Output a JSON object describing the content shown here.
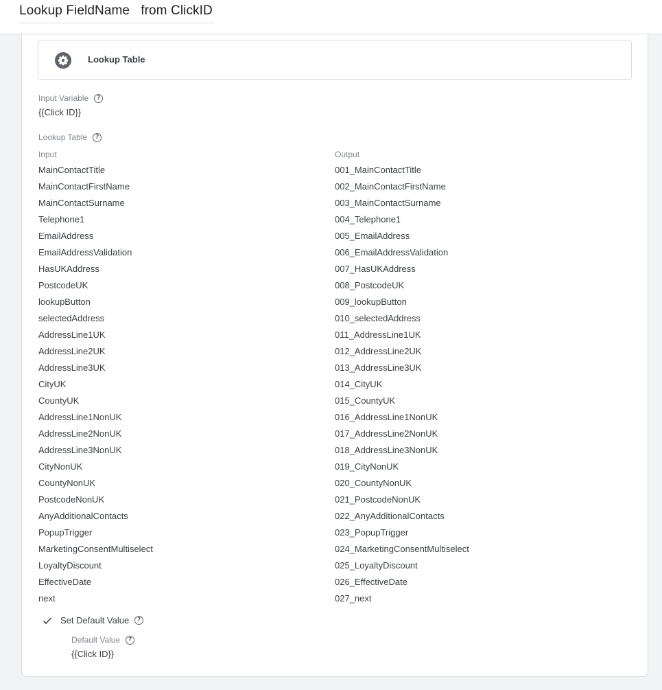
{
  "header": {
    "title": "Lookup FieldName   from ClickID"
  },
  "variable_type": {
    "label": "Lookup Table",
    "icon": "gear-icon"
  },
  "input_variable": {
    "label": "Input Variable",
    "value": "{{Click ID}}"
  },
  "lookup_table": {
    "label": "Lookup Table",
    "input_header": "Input",
    "output_header": "Output",
    "rows": [
      {
        "input": "MainContactTitle",
        "output": "001_MainContactTitle"
      },
      {
        "input": "MainContactFirstName",
        "output": "002_MainContactFirstName"
      },
      {
        "input": "MainContactSurname",
        "output": "003_MainContactSurname"
      },
      {
        "input": "Telephone1",
        "output": "004_Telephone1"
      },
      {
        "input": "EmailAddress",
        "output": "005_EmailAddress"
      },
      {
        "input": "EmailAddressValidation",
        "output": "006_EmailAddressValidation"
      },
      {
        "input": "HasUKAddress",
        "output": "007_HasUKAddress"
      },
      {
        "input": "PostcodeUK",
        "output": "008_PostcodeUK"
      },
      {
        "input": "lookupButton",
        "output": "009_lookupButton"
      },
      {
        "input": "selectedAddress",
        "output": "010_selectedAddress"
      },
      {
        "input": "AddressLine1UK",
        "output": "011_AddressLine1UK"
      },
      {
        "input": "AddressLine2UK",
        "output": "012_AddressLine2UK"
      },
      {
        "input": "AddressLine3UK",
        "output": "013_AddressLine3UK"
      },
      {
        "input": "CityUK",
        "output": "014_CityUK"
      },
      {
        "input": "CountyUK",
        "output": "015_CountyUK"
      },
      {
        "input": "AddressLine1NonUK",
        "output": "016_AddressLine1NonUK"
      },
      {
        "input": "AddressLine2NonUK",
        "output": "017_AddressLine2NonUK"
      },
      {
        "input": "AddressLine3NonUK",
        "output": "018_AddressLine3NonUK"
      },
      {
        "input": "CityNonUK",
        "output": "019_CityNonUK"
      },
      {
        "input": "CountyNonUK",
        "output": "020_CountyNonUK"
      },
      {
        "input": "PostcodeNonUK",
        "output": "021_PostcodeNonUK"
      },
      {
        "input": "AnyAdditionalContacts",
        "output": "022_AnyAdditionalContacts"
      },
      {
        "input": "PopupTrigger",
        "output": "023_PopupTrigger"
      },
      {
        "input": "MarketingConsentMultiselect",
        "output": "024_MarketingConsentMultiselect"
      },
      {
        "input": "LoyaltyDiscount",
        "output": "025_LoyaltyDiscount"
      },
      {
        "input": "EffectiveDate",
        "output": "026_EffectiveDate"
      },
      {
        "input": "next",
        "output": "027_next"
      }
    ]
  },
  "default_value": {
    "checkbox_label": "Set Default Value",
    "checked": true,
    "label": "Default Value",
    "value": "{{Click ID}}"
  },
  "help_icon_glyph": "?"
}
